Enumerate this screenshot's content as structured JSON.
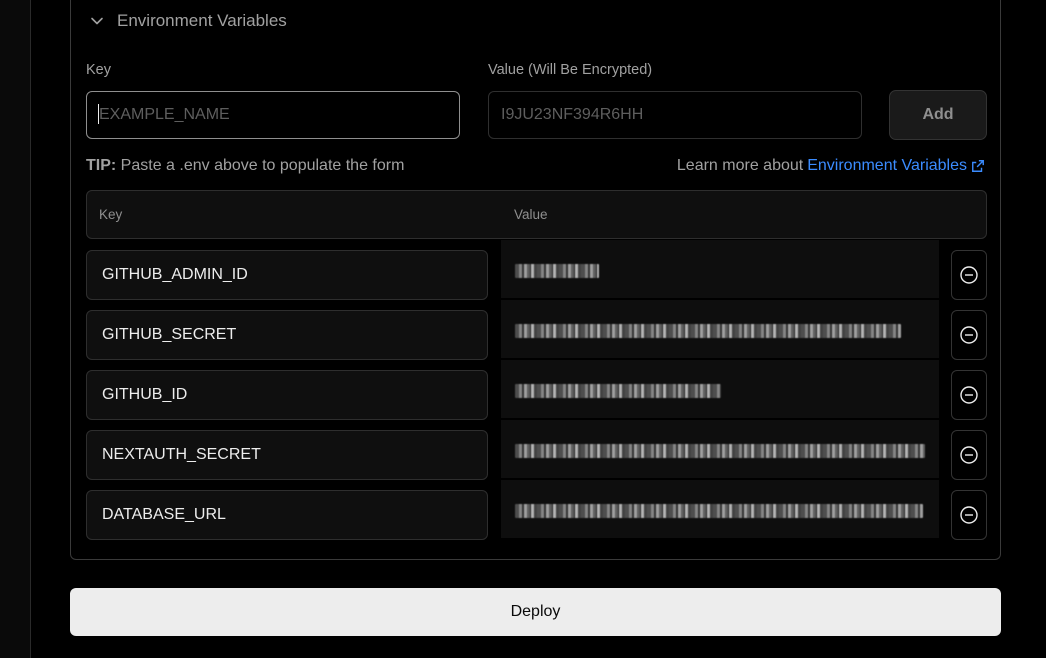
{
  "section": {
    "title": "Environment Variables"
  },
  "form": {
    "key_label": "Key",
    "key_placeholder": "EXAMPLE_NAME",
    "value_label": "Value (Will Be Encrypted)",
    "value_placeholder": "I9JU23NF394R6HH",
    "add_label": "Add"
  },
  "tip": {
    "bold": "TIP:",
    "text": "Paste a .env above to populate the form",
    "learn_prefix": "Learn more about",
    "learn_link": "Environment Variables"
  },
  "table": {
    "headers": {
      "key": "Key",
      "value": "Value"
    },
    "rows": [
      {
        "key": "GITHUB_ADMIN_ID",
        "value_masked": true
      },
      {
        "key": "GITHUB_SECRET",
        "value_masked": true
      },
      {
        "key": "GITHUB_ID",
        "value_masked": true
      },
      {
        "key": "NEXTAUTH_SECRET",
        "value_masked": true
      },
      {
        "key": "DATABASE_URL",
        "value_masked": true
      }
    ]
  },
  "deploy": {
    "label": "Deploy"
  },
  "colors": {
    "accent": "#3b8cff",
    "deploy_bg": "#ededed"
  }
}
